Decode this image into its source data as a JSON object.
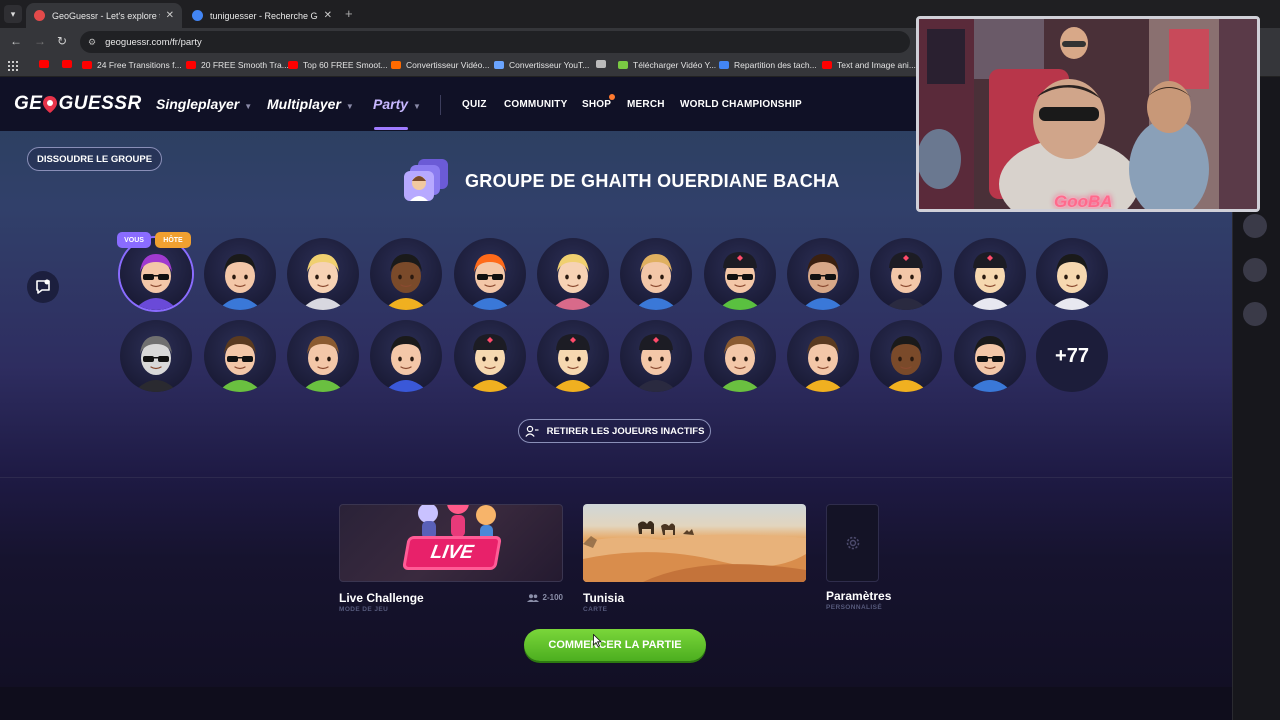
{
  "browser": {
    "tabs": [
      {
        "title": "GeoGuessr - Let's explore the w",
        "close": "✕",
        "active": true
      },
      {
        "title": "tuniguesser - Recherche Googl",
        "close": "✕",
        "active": false
      }
    ],
    "new_tab": "+",
    "address": "geoguessr.com/fr/party",
    "bookmarks": [
      {
        "label": "",
        "color": "#ff0000"
      },
      {
        "label": "",
        "color": "#ff0000"
      },
      {
        "label": "24 Free Transitions f...",
        "color": "#ff0000"
      },
      {
        "label": "20 FREE Smooth Tra...",
        "color": "#ff0000"
      },
      {
        "label": "Top 60 FREE Smoot...",
        "color": "#ff0000"
      },
      {
        "label": "Convertisseur Vidéo...",
        "color": "#ff6a00"
      },
      {
        "label": "Convertisseur YouT...",
        "color": "#6aa4ff"
      },
      {
        "label": "",
        "color": "#bbbbbb"
      },
      {
        "label": "Télécharger Vidéo Y...",
        "color": "#7ac943"
      },
      {
        "label": "Repartition des tach...",
        "color": "#4285f4"
      },
      {
        "label": "Text and Image ani...",
        "color": "#ff0000"
      }
    ]
  },
  "nav": {
    "logo_left": "GE",
    "logo_right": "GUESSR",
    "singleplayer": "Singleplayer",
    "multiplayer": "Multiplayer",
    "party": "Party",
    "quiz": "QUIZ",
    "community": "COMMUNITY",
    "shop": "SHOP",
    "merch": "MERCH",
    "world_championship": "WORLD CHAMPIONSHIP"
  },
  "group": {
    "dissolve_label": "DISSOUDRE LE GROUPE",
    "title": "GROUPE DE GHAITH OUERDIANE BACHA",
    "badge_you": "VOUS",
    "badge_host": "HÔTE",
    "more_count": "+77",
    "remove_inactive_label": "RETIRER LES JOUEURS INACTIFS"
  },
  "cards": {
    "mode": {
      "banner": "LIVE",
      "title": "Live Challenge",
      "sub": "MODE DE JEU",
      "players": "2-100"
    },
    "map": {
      "title": "Tunisia",
      "sub": "CARTE"
    },
    "settings": {
      "title": "Paramètres",
      "sub": "PERSONNALISÉ"
    }
  },
  "start_label": "COMMENCER LA PARTIE",
  "webcam": {
    "name": "GooBA"
  },
  "colors": {
    "accent": "#9f7bff",
    "start_green": "#5cbf28",
    "live_pink": "#e8216a",
    "badge_you": "#8a6cff",
    "badge_host": "#f0a030"
  }
}
